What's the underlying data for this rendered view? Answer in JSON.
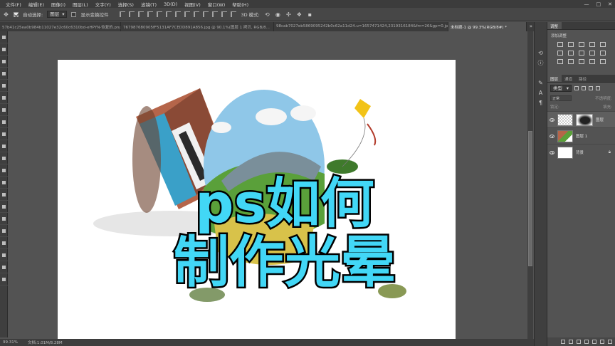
{
  "menubar": {
    "items": [
      "文件(F)",
      "编辑(E)",
      "图像(I)",
      "图层(L)",
      "文字(Y)",
      "选择(S)",
      "滤镜(T)",
      "3D(D)",
      "视图(V)",
      "窗口(W)",
      "帮助(H)"
    ],
    "minimize": "—",
    "maximize": "□",
    "close": "✕"
  },
  "options": {
    "auto_select_label": "自动选择:",
    "auto_select_value": "图层",
    "transform_label": "显示变换控件"
  },
  "tabs": [
    {
      "label": "57b41c25ea0b984b11027e32c60c6310bd-eHPYN-恢复的.png",
      "active": false
    },
    {
      "label": "767987680905fF5131AF7CEDD891A856.jpg @ 90.1%(图层 1 拷贝, RGB/8...",
      "active": false
    },
    {
      "label": "98cab7027eb5869095242b0c62a11d24.u=1657471424,2319316184&fm=26&gp=0.jpg",
      "active": false
    },
    {
      "label": "未标题-1 @ 99.3%(RGB/8#) *",
      "active": true
    }
  ],
  "tabs_more": "»",
  "status": {
    "zoom": "99.31%",
    "doc": "文档:1.01M/8.28M"
  },
  "overlay": {
    "line1": "ps如何",
    "line2": "制作光晕"
  },
  "icons_right": [
    "history-icon",
    "info-icon",
    "brush-preset-icon",
    "char-icon",
    "paragraph-icon"
  ],
  "panels": {
    "adjust_tabs": [
      "调整"
    ],
    "adjust_title": "添加调整",
    "layer_tabs": [
      "图层",
      "通道",
      "路径"
    ],
    "filter_kind": "类型",
    "blend_mode": "正常",
    "opacity_label": "不透明度:",
    "lock_label": "锁定:",
    "fill_label": "填充:",
    "layers": [
      {
        "name": "图层",
        "selected": true,
        "thumb": "checker",
        "mask": true,
        "lock": false
      },
      {
        "name": "图层 1",
        "selected": false,
        "thumb": "image",
        "mask": false,
        "lock": false
      },
      {
        "name": "背景",
        "selected": false,
        "thumb": "white",
        "mask": false,
        "lock": true
      }
    ]
  }
}
